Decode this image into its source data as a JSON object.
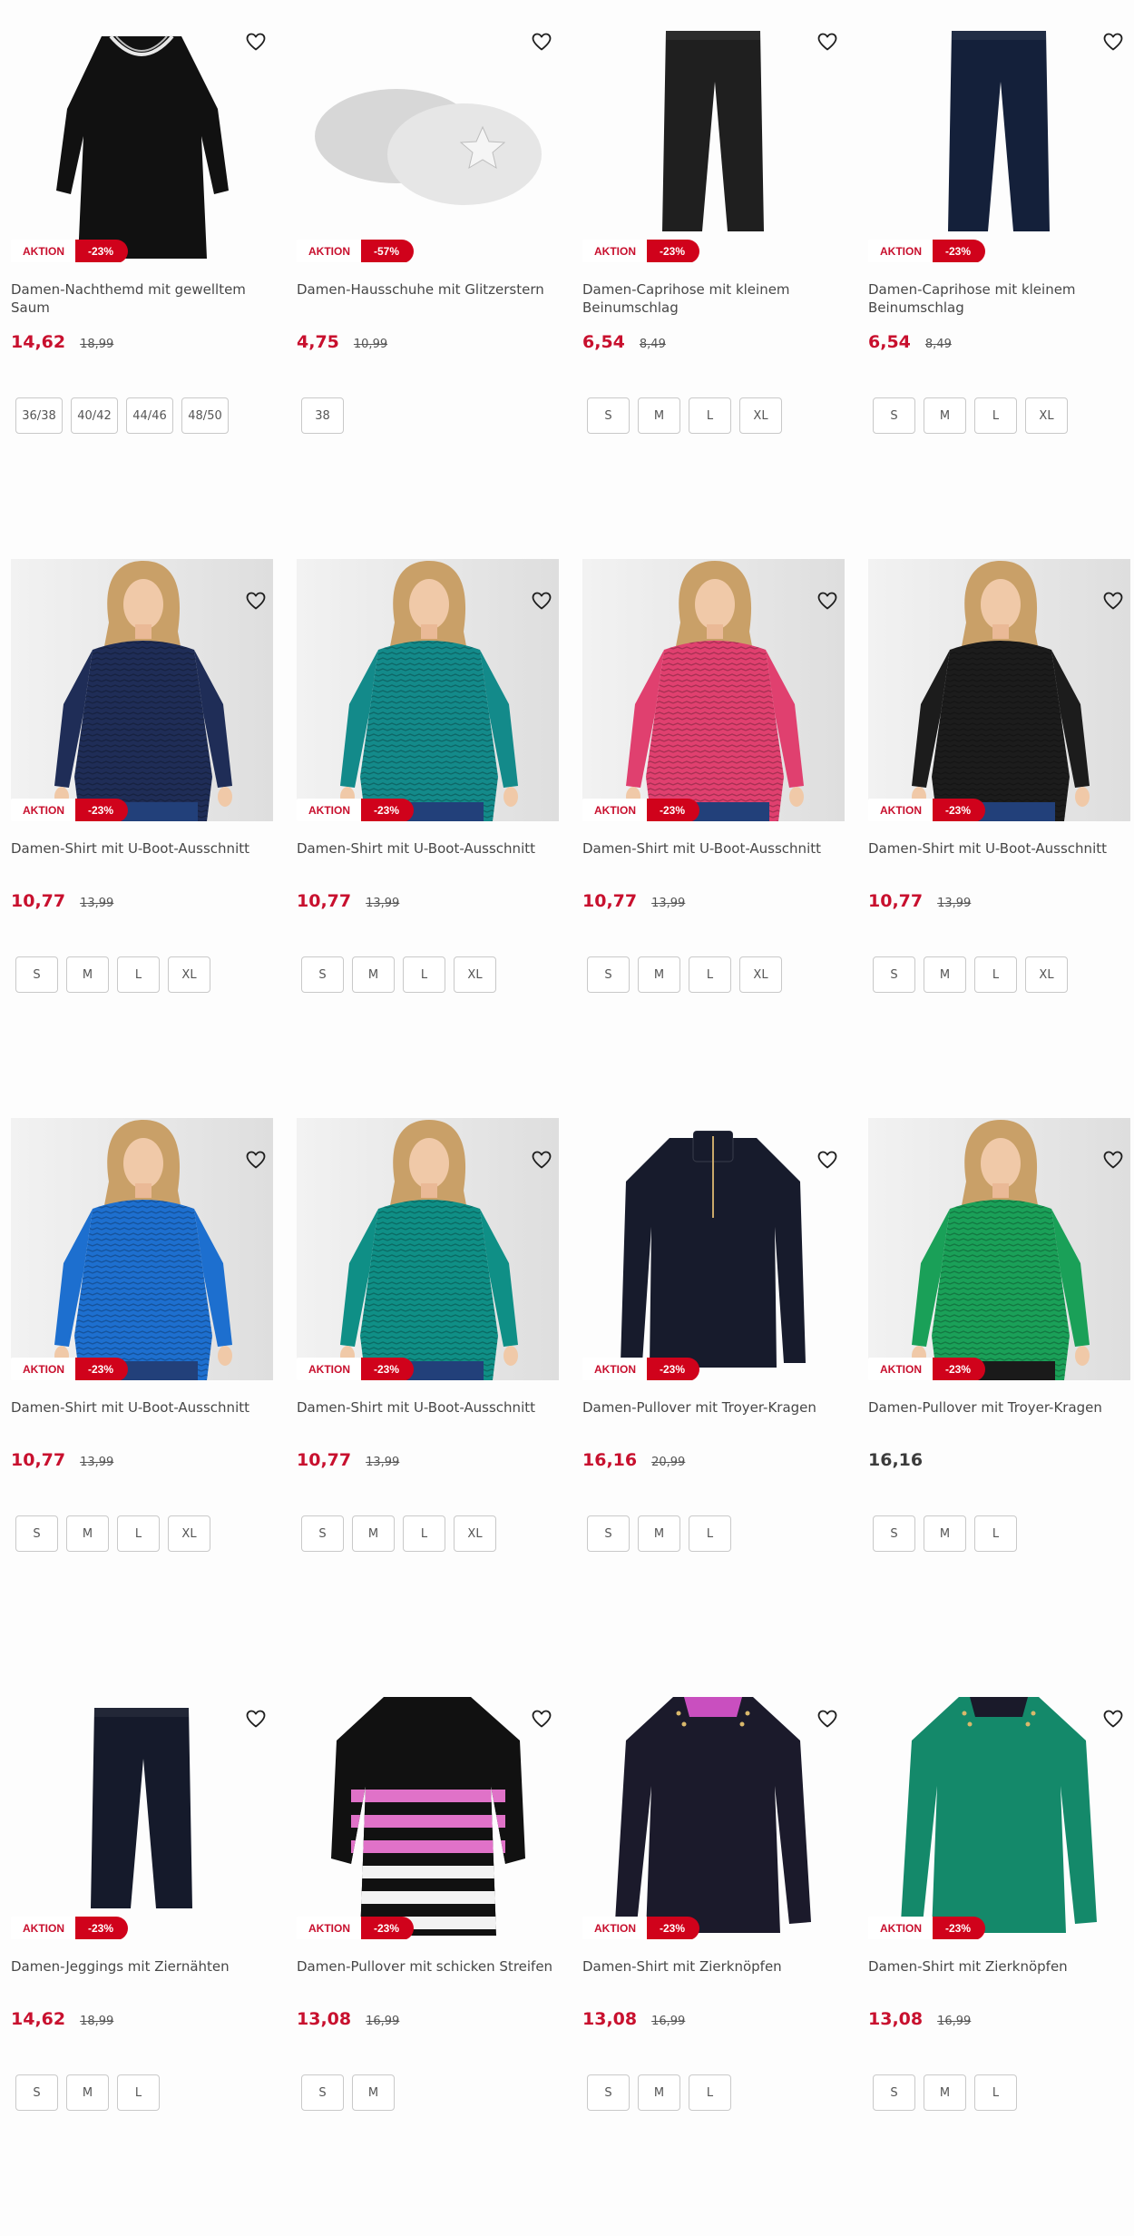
{
  "products": [
    {
      "name": "Damen-Nachthemd mit gewelltem Saum",
      "badge": "AKTION",
      "discount": "-23%",
      "price": "14,62",
      "old_price": "18,99",
      "sizes": [
        "36/38",
        "40/42",
        "44/46",
        "48/50"
      ]
    },
    {
      "name": "Damen-Hausschuhe mit Glitzerstern",
      "badge": "AKTION",
      "discount": "-57%",
      "price": "4,75",
      "old_price": "10,99",
      "sizes": [
        "38"
      ]
    },
    {
      "name": "Damen-Caprihose mit kleinem Beinumschlag",
      "badge": "AKTION",
      "discount": "-23%",
      "price": "6,54",
      "old_price": "8,49",
      "sizes": [
        "S",
        "M",
        "L",
        "XL"
      ]
    },
    {
      "name": "Damen-Caprihose mit kleinem Beinumschlag",
      "badge": "AKTION",
      "discount": "-23%",
      "price": "6,54",
      "old_price": "8,49",
      "sizes": [
        "S",
        "M",
        "L",
        "XL"
      ]
    },
    {
      "name": "Damen-Shirt mit U-Boot-Ausschnitt",
      "badge": "AKTION",
      "discount": "-23%",
      "price": "10,77",
      "old_price": "13,99",
      "sizes": [
        "S",
        "M",
        "L",
        "XL"
      ]
    },
    {
      "name": "Damen-Shirt mit U-Boot-Ausschnitt",
      "badge": "AKTION",
      "discount": "-23%",
      "price": "10,77",
      "old_price": "13,99",
      "sizes": [
        "S",
        "M",
        "L",
        "XL"
      ]
    },
    {
      "name": "Damen-Shirt mit U-Boot-Ausschnitt",
      "badge": "AKTION",
      "discount": "-23%",
      "price": "10,77",
      "old_price": "13,99",
      "sizes": [
        "S",
        "M",
        "L",
        "XL"
      ]
    },
    {
      "name": "Damen-Shirt mit U-Boot-Ausschnitt",
      "badge": "AKTION",
      "discount": "-23%",
      "price": "10,77",
      "old_price": "13,99",
      "sizes": [
        "S",
        "M",
        "L",
        "XL"
      ]
    },
    {
      "name": "Damen-Shirt mit U-Boot-Ausschnitt",
      "badge": "AKTION",
      "discount": "-23%",
      "price": "10,77",
      "old_price": "13,99",
      "sizes": [
        "S",
        "M",
        "L",
        "XL"
      ]
    },
    {
      "name": "Damen-Shirt mit U-Boot-Ausschnitt",
      "badge": "AKTION",
      "discount": "-23%",
      "price": "10,77",
      "old_price": "13,99",
      "sizes": [
        "S",
        "M",
        "L",
        "XL"
      ]
    },
    {
      "name": "Damen-Pullover mit Troyer-Kragen",
      "badge": "AKTION",
      "discount": "-23%",
      "price": "16,16",
      "old_price": "20,99",
      "sizes": [
        "S",
        "M",
        "L"
      ]
    },
    {
      "name": "Damen-Pullover mit Troyer-Kragen",
      "badge": "AKTION",
      "discount": "-23%",
      "price": "16,16",
      "old_price": "",
      "sizes": [
        "S",
        "M",
        "L"
      ]
    },
    {
      "name": "Damen-Jeggings mit Ziernähten",
      "badge": "AKTION",
      "discount": "-23%",
      "price": "14,62",
      "old_price": "18,99",
      "sizes": [
        "S",
        "M",
        "L"
      ]
    },
    {
      "name": "Damen-Pullover mit schicken Streifen",
      "badge": "AKTION",
      "discount": "-23%",
      "price": "13,08",
      "old_price": "16,99",
      "sizes": [
        "S",
        "M"
      ]
    },
    {
      "name": "Damen-Shirt mit Zierknöpfen",
      "badge": "AKTION",
      "discount": "-23%",
      "price": "13,08",
      "old_price": "16,99",
      "sizes": [
        "S",
        "M",
        "L"
      ]
    },
    {
      "name": "Damen-Shirt mit Zierknöpfen",
      "badge": "AKTION",
      "discount": "-23%",
      "price": "13,08",
      "old_price": "16,99",
      "sizes": [
        "S",
        "M",
        "L"
      ]
    }
  ],
  "icons": {
    "favorite": "heart-outline-icon"
  },
  "colors": {
    "sale_red": "#c8102e",
    "badge_red": "#d0021b",
    "text": "#474747",
    "size_border": "#c9c9c9"
  }
}
